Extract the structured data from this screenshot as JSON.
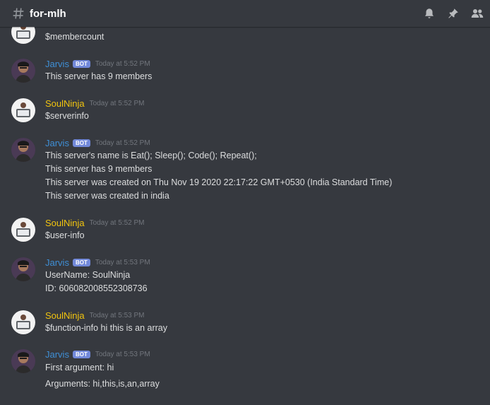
{
  "channel": {
    "name": "for-mlh",
    "hash_icon": "hash-icon"
  },
  "toolbar": {
    "icons": [
      "bell-icon",
      "pin-icon",
      "members-icon"
    ]
  },
  "colors": {
    "background": "#36393f",
    "jarvis": "#3f8fd6",
    "soulninja": "#f1c40f",
    "bot_tag": "#7289da",
    "timestamp": "#72767d"
  },
  "bot_label": "BOT",
  "messages": [
    {
      "kind": "continuation",
      "lines": [
        "$membercount"
      ]
    },
    {
      "author": "Jarvis",
      "bot": true,
      "time": "Today at 5:52 PM",
      "lines": [
        "This server has 9 members"
      ]
    },
    {
      "author": "SoulNinja",
      "bot": false,
      "time": "Today at 5:52 PM",
      "lines": [
        "$serverinfo"
      ]
    },
    {
      "author": "Jarvis",
      "bot": true,
      "time": "Today at 5:52 PM",
      "lines": [
        "This server's name is Eat(); Sleep(); Code(); Repeat();",
        "This server has 9 members",
        "This server was created on Thu Nov 19 2020 22:17:22 GMT+0530 (India Standard Time)",
        "This server was created in india"
      ]
    },
    {
      "author": "SoulNinja",
      "bot": false,
      "time": "Today at 5:52 PM",
      "lines": [
        "$user-info"
      ]
    },
    {
      "author": "Jarvis",
      "bot": true,
      "time": "Today at 5:53 PM",
      "lines": [
        "UserName: SoulNinja",
        "ID: 606082008552308736"
      ]
    },
    {
      "author": "SoulNinja",
      "bot": false,
      "time": "Today at 5:53 PM",
      "lines": [
        "$function-info hi this is an array"
      ]
    },
    {
      "author": "Jarvis",
      "bot": true,
      "time": "Today at 5:53 PM",
      "lines": [
        "First argument: hi",
        "Arguments: hi,this,is,an,array"
      ]
    }
  ]
}
